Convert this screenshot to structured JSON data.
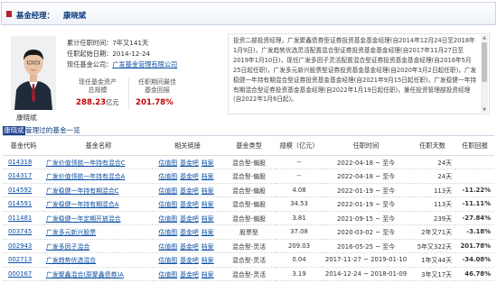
{
  "header": {
    "label": "基金经理：",
    "name": "康晓斌"
  },
  "profile": {
    "name": "康晓斌",
    "rows": [
      {
        "label": "累计任职时间：",
        "value": "7年又141天"
      },
      {
        "label": "任职起始日期：",
        "value": "2014-12-24"
      },
      {
        "label": "现任基金公司：",
        "value": "广发基金管理有限公司"
      }
    ],
    "stat1_label_1": "现任基金资产",
    "stat1_label_2": "总规模",
    "stat1_value": "288.23",
    "stat1_unit": "亿元",
    "stat2_label_1": "任职期间最佳",
    "stat2_label_2": "基金回报",
    "stat2_value": "201.78%"
  },
  "bio": {
    "text": "投资二部投资经理，广发聚鑫债券型证券投资基金基金经理(自2014年12月24日至2018年1月9日)，广发趋势优选灵活配置混合型证券投资基金基金经理(自2017年11月27日至2019年1月10日)，现任广发多因子灵活配置混合型证券投资基金基金经理(自2016年5月25日起任职)，广发多元新兴股票型证券投资基金基金经理(自2020年3月2日起任职)，广发稳健一年持有期混合型证券投资基金基金经理(自2021年9月15日起任职)，广发稳健一年持有期混合型证券投资基金基金经理(自2022年1月19日起任职)，兼任投资管理部投资经理(自2022年1月6日起)。"
  },
  "section": {
    "name": "康晓斌",
    "rest": "管理过的基金一览"
  },
  "table": {
    "headers": [
      "基金代码",
      "基金名称",
      "相关链接",
      "基金类型",
      "规模（亿元）",
      "任职时间",
      "任职天数",
      "任职回报"
    ],
    "link_labels": [
      "估值图",
      "基金吧",
      "档案"
    ],
    "rows": [
      {
        "code": "014318",
        "name": "广发价值领航一年持有混合C",
        "type": "混合型-偏股",
        "scale": "--",
        "period": "2022-04-18 ~ 至今",
        "days": "24天",
        "ret": "",
        "ret_color": ""
      },
      {
        "code": "014317",
        "name": "广发价值领航一年持有混合A",
        "type": "混合型-偏股",
        "scale": "--",
        "period": "2022-04-18 ~ 至今",
        "days": "24天",
        "ret": "",
        "ret_color": ""
      },
      {
        "code": "014592",
        "name": "广发稳健一年持有期混合C",
        "type": "混合型-偏股",
        "scale": "4.08",
        "period": "2022-01-19 ~ 至今",
        "days": "113天",
        "ret": "-11.22%",
        "ret_color": "green"
      },
      {
        "code": "014591",
        "name": "广发稳健一年持有期混合A",
        "type": "混合型-偏股",
        "scale": "34.53",
        "period": "2022-01-19 ~ 至今",
        "days": "113天",
        "ret": "-11.11%",
        "ret_color": "green"
      },
      {
        "code": "011481",
        "name": "广发稳健一年定期开放混合",
        "type": "混合型-偏股",
        "scale": "3.81",
        "period": "2021-09-15 ~ 至今",
        "days": "239天",
        "ret": "-27.84%",
        "ret_color": "green"
      },
      {
        "code": "003745",
        "name": "广发多元新兴股票",
        "type": "股票型",
        "scale": "37.08",
        "period": "2020-03-02 ~ 至今",
        "days": "2年又71天",
        "ret": "-3.18%",
        "ret_color": "green"
      },
      {
        "code": "002943",
        "name": "广发多因子混合",
        "type": "混合型-灵活",
        "scale": "209.03",
        "period": "2016-05-25 ~ 至今",
        "days": "5年又322天",
        "ret": "201.78%",
        "ret_color": "red"
      },
      {
        "code": "002713",
        "name": "广发趋势优选混合",
        "type": "混合型-灵活",
        "scale": "0.04",
        "period": "2017-11-27 ~ 2019-01-10",
        "days": "1年又44天",
        "ret": "-34.08%",
        "ret_color": "green"
      },
      {
        "code": "000167",
        "name": "广发聚鑫混合(原聚鑫债券)A",
        "type": "混合型-灵活",
        "scale": "3.19",
        "period": "2014-12-24 ~ 2018-01-09",
        "days": "3年又17天",
        "ret": "46.78%",
        "ret_color": "red"
      }
    ]
  }
}
